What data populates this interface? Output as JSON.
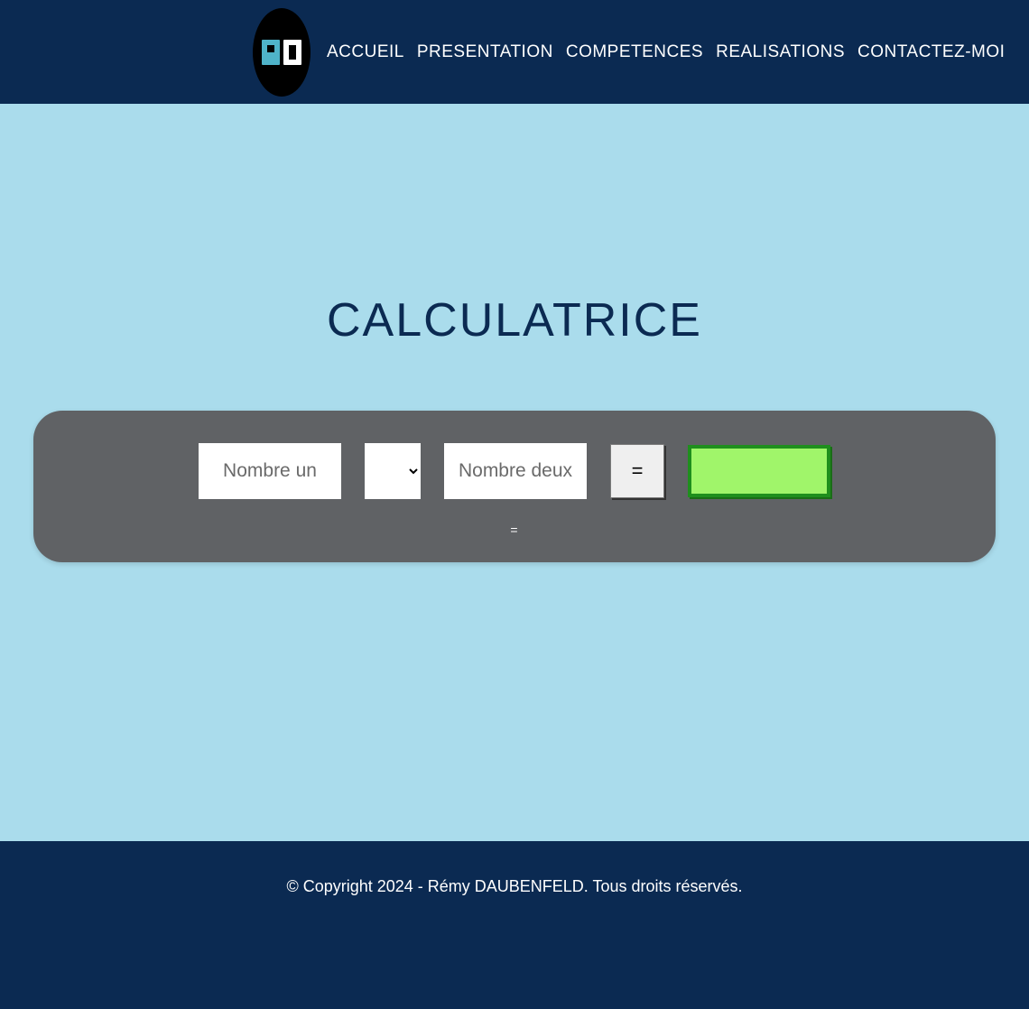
{
  "header": {
    "nav": {
      "accueil": "ACCUEIL",
      "presentation": "PRESENTATION",
      "competences": "COMPETENCES",
      "realisations": "REALISATIONS",
      "contactez": "CONTACTEZ-MOI"
    }
  },
  "main": {
    "title": "CALCULATRICE",
    "form": {
      "num1_placeholder": "Nombre un",
      "num2_placeholder": "Nombre deux",
      "operator_selected": "",
      "equals_label": "=",
      "result_value": "",
      "text_row": "="
    }
  },
  "footer": {
    "copyright": "© Copyright 2024 - Rémy DAUBENFELD. Tous droits réservés."
  },
  "colors": {
    "header_bg": "#0b2a52",
    "body_bg": "#aadcec",
    "card_bg": "#606265",
    "result_bg": "#a0f56a",
    "result_border": "#1f8f1d"
  }
}
